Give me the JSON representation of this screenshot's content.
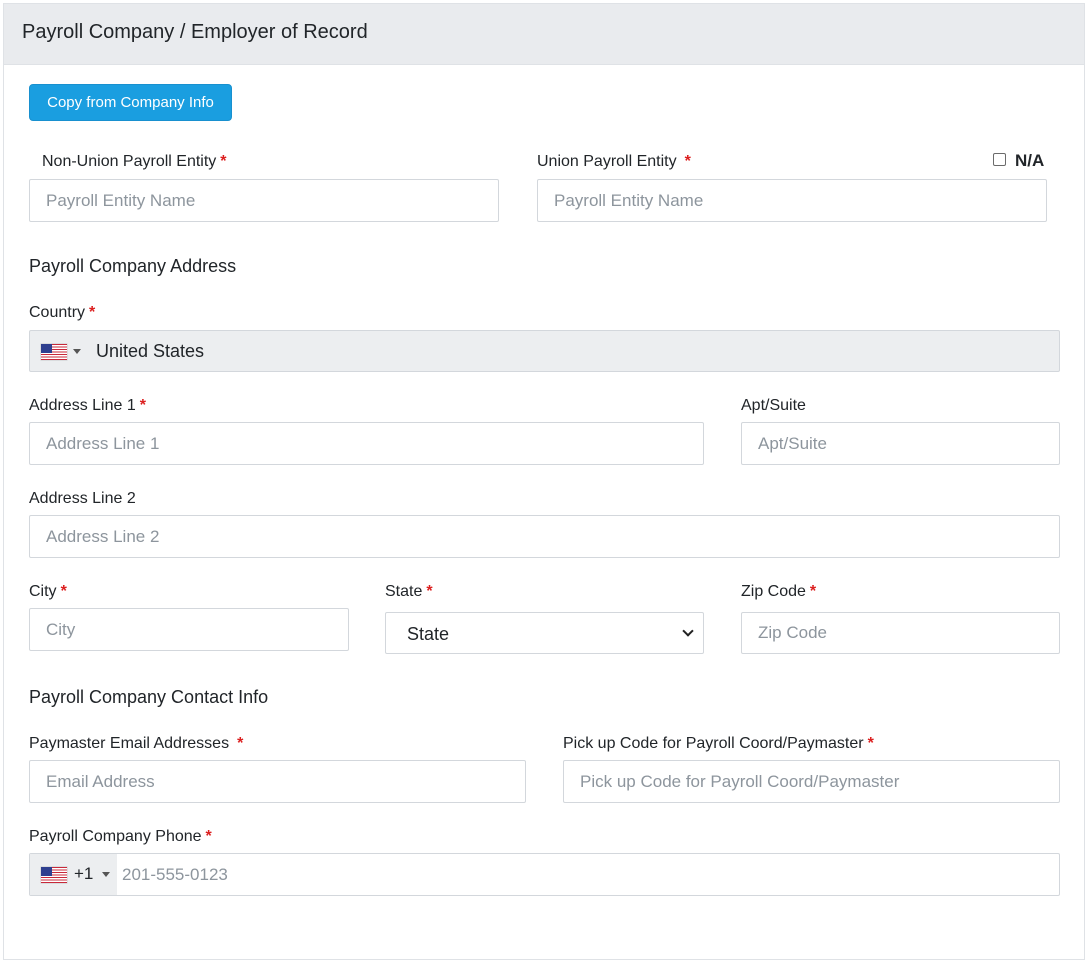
{
  "header": {
    "title": "Payroll Company / Employer of Record"
  },
  "copy_button": {
    "label": "Copy from Company Info"
  },
  "required_mark": "*",
  "non_union": {
    "label": "Non-Union Payroll Entity",
    "placeholder": "Payroll Entity Name",
    "value": ""
  },
  "union": {
    "label": "Union Payroll Entity",
    "placeholder": "Payroll Entity Name",
    "value": ""
  },
  "na": {
    "label": "N/A",
    "checked": false
  },
  "address_section": {
    "title": "Payroll Company Address"
  },
  "country": {
    "label": "Country",
    "value": "United States",
    "flag_icon": "us-flag-icon"
  },
  "address1": {
    "label": "Address Line 1",
    "placeholder": "Address Line 1",
    "value": ""
  },
  "apt": {
    "label": "Apt/Suite",
    "placeholder": "Apt/Suite",
    "value": ""
  },
  "address2": {
    "label": "Address Line 2",
    "placeholder": "Address Line 2",
    "value": ""
  },
  "city": {
    "label": "City",
    "placeholder": "City",
    "value": ""
  },
  "state": {
    "label": "State",
    "value": "State"
  },
  "zip": {
    "label": "Zip Code",
    "placeholder": "Zip Code",
    "value": ""
  },
  "contact_section": {
    "title": "Payroll Company Contact Info"
  },
  "email": {
    "label": "Paymaster Email Addresses",
    "placeholder": "Email Address",
    "value": ""
  },
  "pickup": {
    "label": "Pick up Code for Payroll Coord/Paymaster",
    "placeholder": "Pick up Code for Payroll Coord/Paymaster",
    "value": ""
  },
  "phone": {
    "label": "Payroll Company Phone",
    "dial_code": "+1",
    "placeholder": "201-555-0123",
    "value": ""
  },
  "colors": {
    "accent": "#1a9ee0",
    "required": "#dc1f1f",
    "header_bg": "#e9ebee",
    "readonly_bg": "#eceef0"
  }
}
